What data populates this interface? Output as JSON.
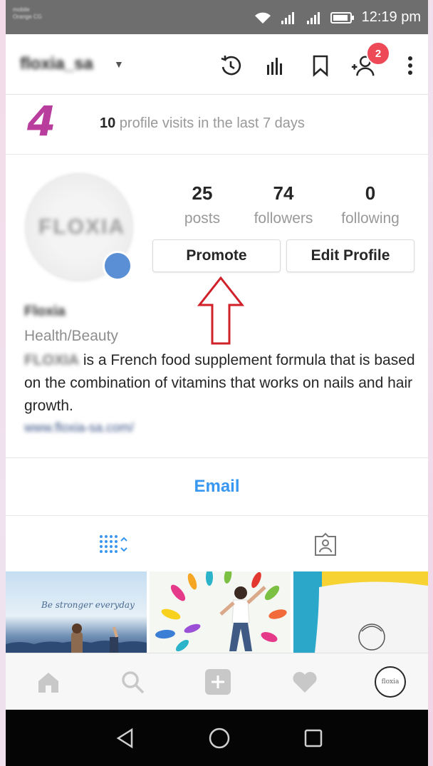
{
  "status_bar": {
    "carrier_line1": "mobile",
    "carrier_line2": "Orange CG",
    "time": "12:19 pm"
  },
  "header": {
    "username": "floxia_sa",
    "notification_count": "2",
    "icons": [
      "history-icon",
      "insights-icon",
      "bookmark-icon",
      "add-person-icon",
      "more-options-icon"
    ]
  },
  "insights": {
    "number": "4",
    "visits_count": "10",
    "visits_text": " profile visits in the last 7 days"
  },
  "profile": {
    "avatar_text": "FLOXIA",
    "stats": [
      {
        "value": "25",
        "label": "posts"
      },
      {
        "value": "74",
        "label": "followers"
      },
      {
        "value": "0",
        "label": "following"
      }
    ],
    "promote_label": "Promote",
    "edit_label": "Edit Profile",
    "name": "Floxia",
    "category": "Health/Beauty",
    "bio_brand": "FLOXIA",
    "bio_text": " is a French food supplement formula that is based on the combination of vitamins that works on nails and hair growth.",
    "website": "www.floxia-sa.com/"
  },
  "contact": {
    "email_label": "Email"
  },
  "grid": {
    "caption_1": "Be stronger everyday"
  },
  "bottom_nav": {
    "profile_avatar_text": "floxia"
  },
  "colors": {
    "accent_blue": "#3897f0",
    "insights_purple": "#b83d9d",
    "badge_red": "#ed4956",
    "annotation_arrow": "#d0202a"
  }
}
